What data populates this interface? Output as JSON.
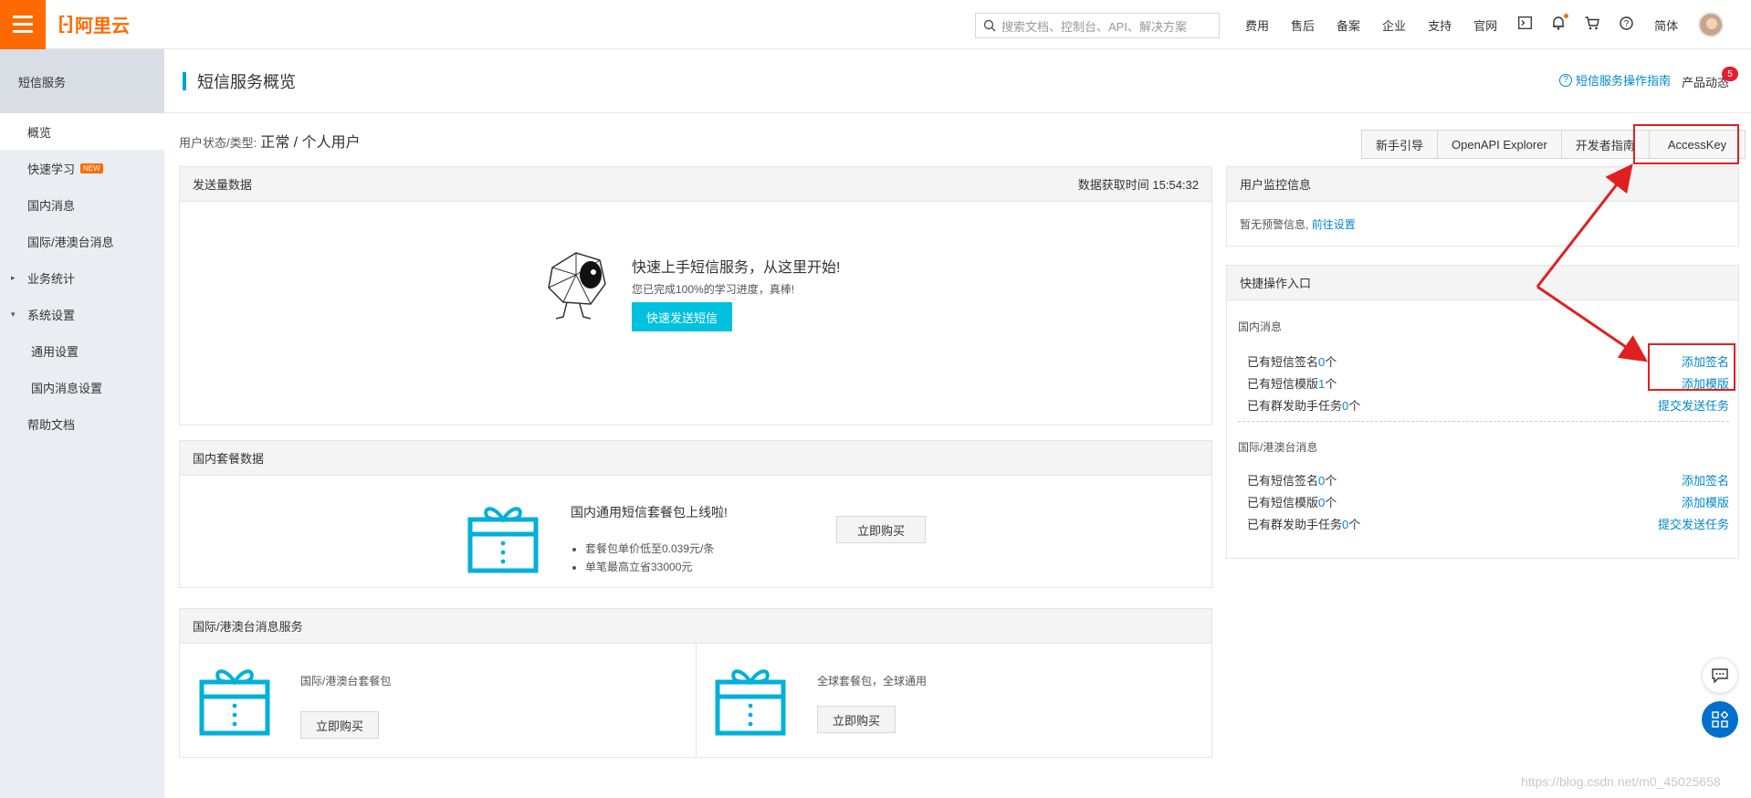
{
  "topbar": {
    "logo_text": "阿里云",
    "search_placeholder": "搜索文档、控制台、API、解决方案",
    "links": [
      "费用",
      "售后",
      "备案",
      "企业",
      "支持",
      "官网"
    ],
    "lang": "简体",
    "icons": [
      "terminal-icon",
      "bell-icon",
      "cart-icon",
      "help-icon"
    ]
  },
  "sidebar": {
    "title": "短信服务",
    "items": [
      {
        "label": "概览",
        "active": true
      },
      {
        "label": "快速学习",
        "badge": "NEW"
      },
      {
        "label": "国内消息"
      },
      {
        "label": "国际/港澳台消息"
      },
      {
        "label": "业务统计",
        "caret": "▸"
      },
      {
        "label": "系统设置",
        "caret": "▾"
      },
      {
        "label": "通用设置",
        "sub": true
      },
      {
        "label": "国内消息设置",
        "sub": true
      },
      {
        "label": "帮助文档"
      }
    ]
  },
  "header": {
    "title": "短信服务概览",
    "guide_link": "短信服务操作指南",
    "product_news": "产品动态",
    "product_news_count": "5"
  },
  "user_status": {
    "label": "用户状态/类型:",
    "value": "正常 / 个人用户"
  },
  "button_group": [
    "新手引导",
    "OpenAPI Explorer",
    "开发者指南",
    "AccessKey"
  ],
  "send_panel": {
    "title": "发送量数据",
    "time_label": "数据获取时间 15:54:32",
    "heading": "快速上手短信服务，从这里开始!",
    "subtext": "您已完成100%的学习进度，真棒!",
    "button": "快速发送短信"
  },
  "package_panel": {
    "title": "国内套餐数据",
    "heading": "国内通用短信套餐包上线啦!",
    "bullets": [
      "套餐包单价低至0.039元/条",
      "单笔最高立省33000元"
    ],
    "button": "立即购买"
  },
  "intl_panel": {
    "title": "国际/港澳台消息服务",
    "cards": [
      {
        "label": "国际/港澳台套餐包",
        "button": "立即购买"
      },
      {
        "label": "全球套餐包，全球通用",
        "button": "立即购买"
      }
    ]
  },
  "monitor_panel": {
    "title": "用户监控信息",
    "text": "暂无预警信息,",
    "link": "前往设置"
  },
  "quick_panel": {
    "title": "快捷操作入口",
    "domestic": {
      "title": "国内消息",
      "rows": [
        {
          "text": "已有短信签名",
          "count": "0",
          "unit": "个",
          "action": "添加签名"
        },
        {
          "text": "已有短信模版",
          "count": "1",
          "unit": "个",
          "action": "添加模版"
        },
        {
          "text": "已有群发助手任务",
          "count": "0",
          "unit": "个",
          "action": "提交发送任务"
        }
      ]
    },
    "intl": {
      "title": "国际/港澳台消息",
      "rows": [
        {
          "text": "已有短信签名",
          "count": "0",
          "unit": "个",
          "action": "添加签名"
        },
        {
          "text": "已有短信模版",
          "count": "0",
          "unit": "个",
          "action": "添加模版"
        },
        {
          "text": "已有群发助手任务",
          "count": "0",
          "unit": "个",
          "action": "提交发送任务"
        }
      ]
    }
  },
  "watermark": "https://blog.csdn.net/m0_45025658",
  "colors": {
    "accent": "#ff6a00",
    "primary": "#00c1de",
    "link": "#0088cc",
    "annotation": "#e02020"
  }
}
